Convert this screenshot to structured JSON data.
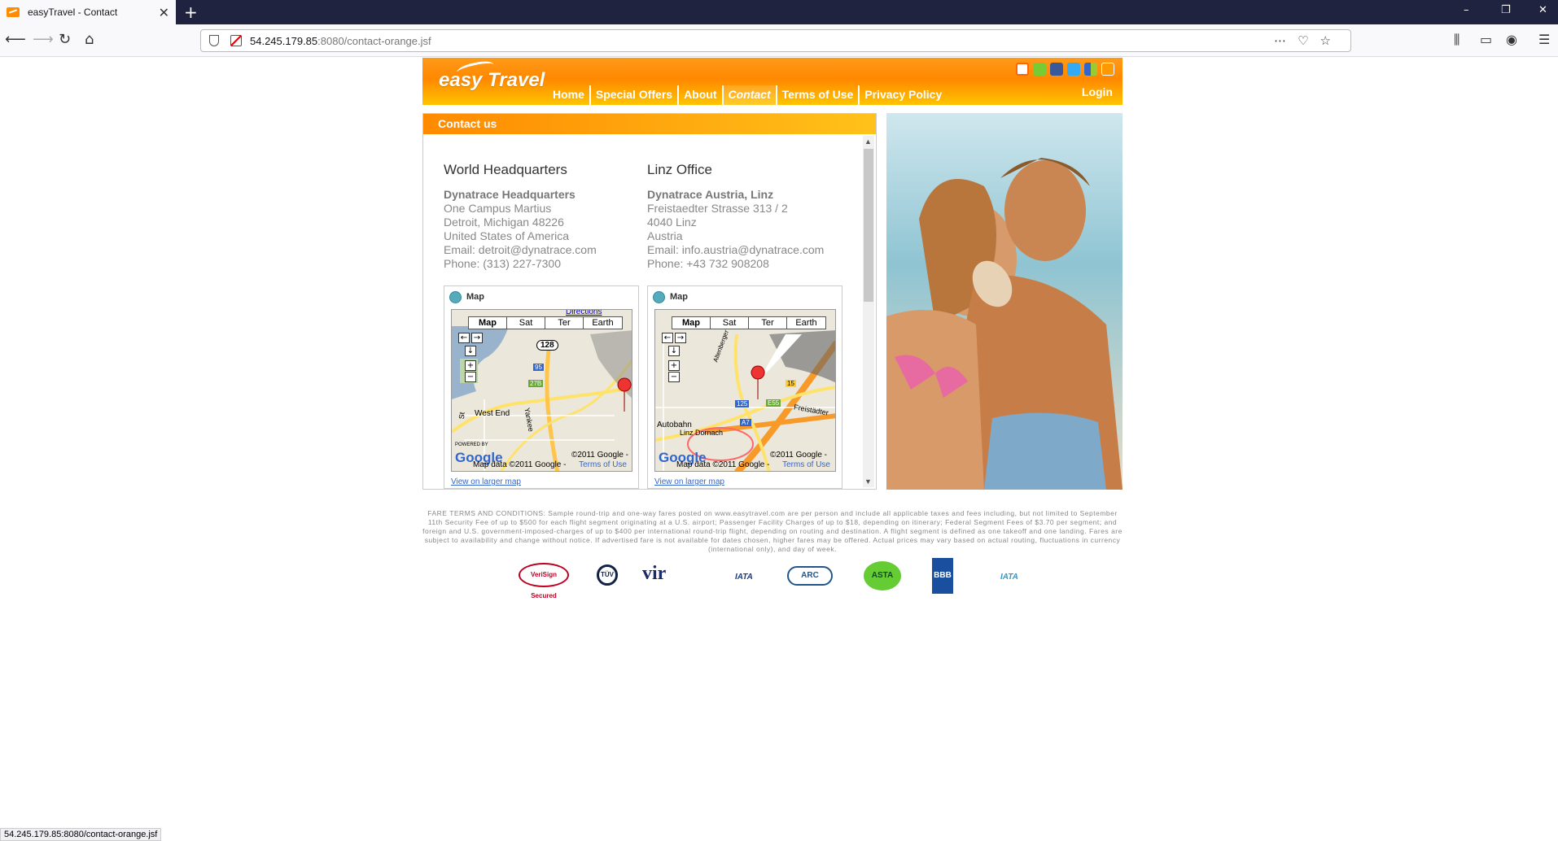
{
  "browser": {
    "tab_title": "easyTravel - Contact",
    "url_host": "54.245.179.85",
    "url_path": ":8080/contact-orange.jsf",
    "status_url": "54.245.179.85:8080/contact-orange.jsf"
  },
  "header": {
    "logo_text": "easy Travel",
    "nav": [
      "Home",
      "Special Offers",
      "About",
      "Contact",
      "Terms of Use",
      "Privacy Policy"
    ],
    "active_nav": "Contact",
    "login_label": "Login",
    "social_icons": [
      "blogger-icon",
      "android-icon",
      "facebook-icon",
      "twitter-icon",
      "delicious-icon",
      "rss-icon"
    ]
  },
  "contact": {
    "panel_title": "Contact us",
    "offices": [
      {
        "heading": "World Headquarters",
        "name": "Dynatrace Headquarters",
        "line1": "One Campus Martius",
        "line2": "Detroit, Michigan 48226",
        "line3": "United States of America",
        "email": "Email: detroit@dynatrace.com",
        "phone": "Phone: (313) 227-7300"
      },
      {
        "heading": "Linz Office",
        "name": "Dynatrace Austria, Linz",
        "line1": "Freistaedter Strasse 313 / 2",
        "line2": "4040 Linz",
        "line3": "Austria",
        "email": "Email: info.austria@dynatrace.com",
        "phone": "Phone: +43 732 908208"
      }
    ],
    "map_label": "Map",
    "map_tabs": [
      "Map",
      "Sat",
      "Ter",
      "Earth"
    ],
    "map_copyright": "©2011 Google -",
    "map_data": "Map data ©2011 Google -",
    "map_terms": "Terms of Use",
    "map_larger": "View on larger map",
    "map_directions": "Directions",
    "map1_labels": {
      "road1": "128",
      "road2": "95",
      "road3": "27B",
      "area": "West End",
      "street": "Yankee",
      "st": "St"
    },
    "map2_labels": {
      "road1": "125",
      "road2": "E55",
      "road3": "A7",
      "road4": "15",
      "place": "Linz Dornach",
      "street": "Freistädter",
      "road5": "Altenberger",
      "road6": "Autobahn"
    },
    "powered_by": "POWERED BY",
    "google": "Google"
  },
  "footer": {
    "fare_text": "FARE TERMS AND CONDITIONS: Sample round-trip and one-way fares posted on www.easytravel.com are per person and include all applicable taxes and fees including, but not limited to September 11th Security Fee of up to $500 for each flight segment originating at a U.S. airport; Passenger Facility Charges of up to $18, depending on itinerary; Federal Segment Fees of $3.70 per segment; and foreign and U.S. government-imposed-charges of up to $400 per international round-trip flight, depending on routing and destination. A flight segment is defined as one takeoff and one landing. Fares are subject to availability and change without notice. If advertised fare is not available for dates chosen, higher fares may be offered. Actual prices may vary based on actual routing, fluctuations in currency (international only), and day of week.",
    "badges": [
      "VeriSign Secured",
      "TÜV",
      "vir",
      "IATA",
      "ARC",
      "ASTA",
      "BBB",
      "IATA"
    ]
  }
}
